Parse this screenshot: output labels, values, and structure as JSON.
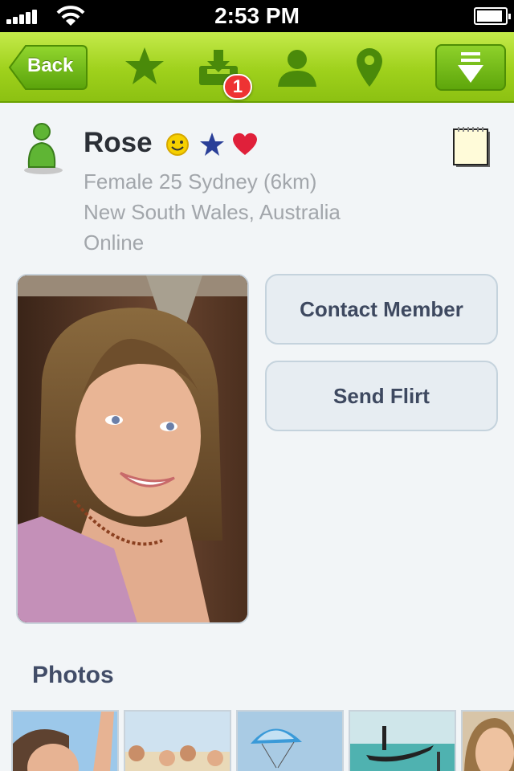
{
  "status_bar": {
    "time": "2:53 PM",
    "battery_level": 0.9
  },
  "toolbar": {
    "back_label": "Back",
    "inbox_badge": "1",
    "icons": [
      "star-icon",
      "inbox-download-icon",
      "person-icon",
      "location-pin-icon",
      "menu-dropdown-icon"
    ]
  },
  "profile": {
    "name": "Rose",
    "details": "Female 25 Sydney (6km)",
    "region": "New South Wales, Australia",
    "status": "Online"
  },
  "actions": {
    "contact": "Contact Member",
    "flirt": "Send Flirt"
  },
  "photos": {
    "heading": "Photos"
  },
  "colors": {
    "toolbar_green": "#9fd11c",
    "icon_green": "#4e8e05",
    "badge_red": "#e33333",
    "button_text": "#3e4960"
  }
}
